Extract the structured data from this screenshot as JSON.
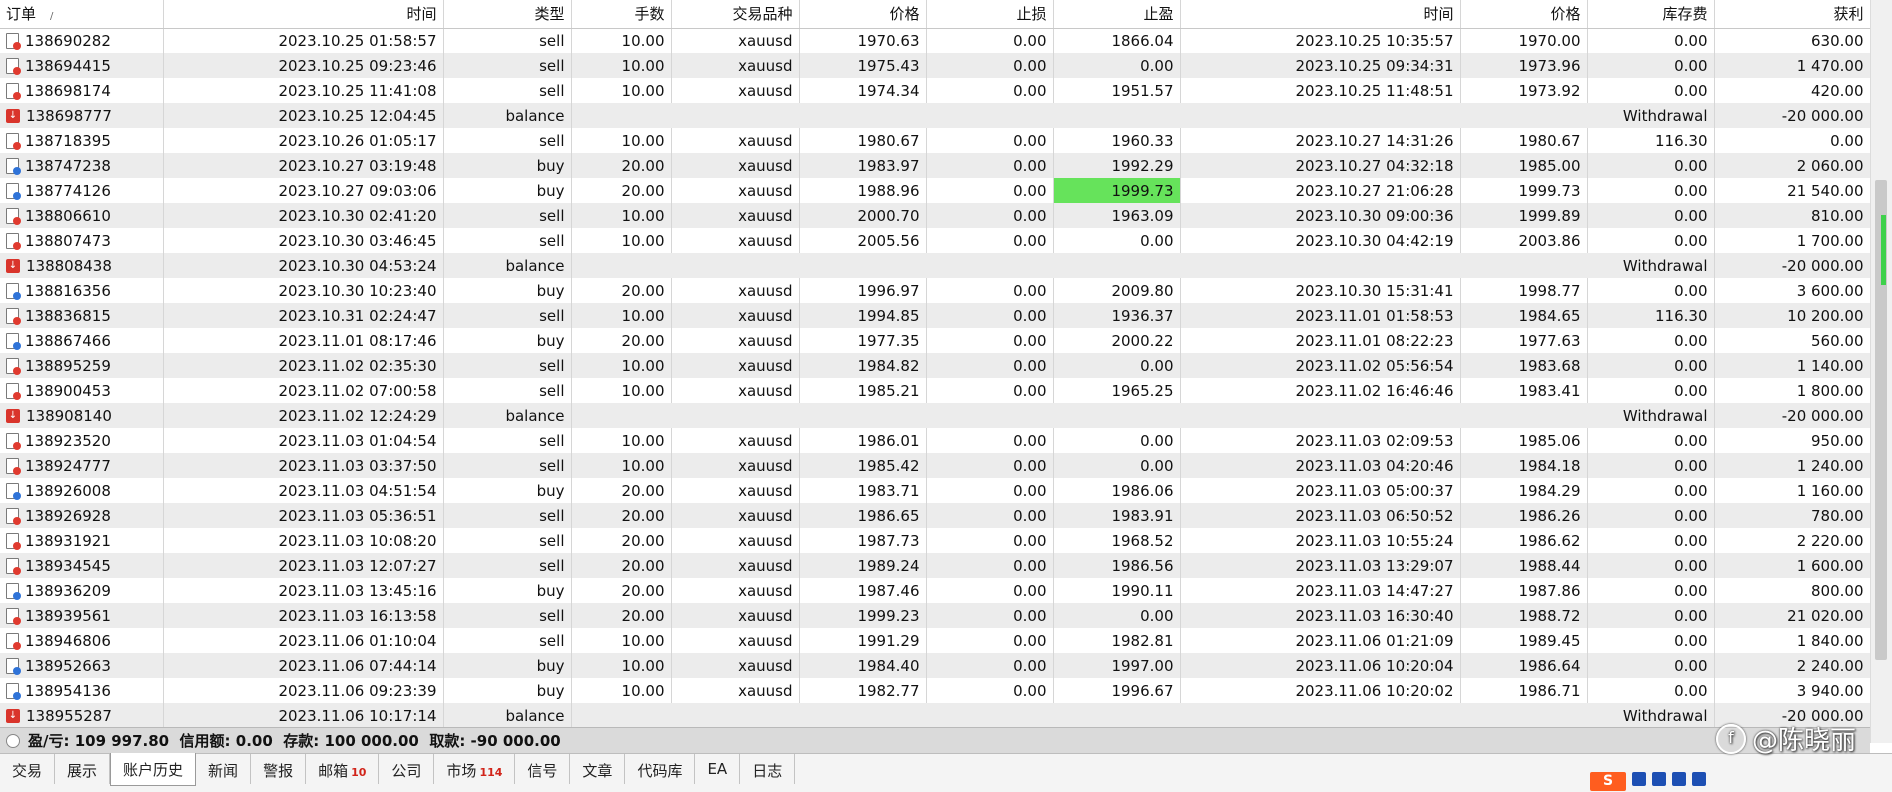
{
  "columns": [
    "订单",
    "时间",
    "类型",
    "手数",
    "交易品种",
    "价格",
    "止损",
    "止盈",
    "时间",
    "价格",
    "库存费",
    "获利"
  ],
  "rows": [
    {
      "order": "138690282",
      "time": "2023.10.25 01:58:57",
      "type": "sell",
      "lots": "10.00",
      "symbol": "xauusd",
      "price": "1970.63",
      "sl": "0.00",
      "tp": "1866.04",
      "close_time": "2023.10.25 10:35:57",
      "close_price": "1970.00",
      "swap": "0.00",
      "profit": "630.00"
    },
    {
      "order": "138694415",
      "time": "2023.10.25 09:23:46",
      "type": "sell",
      "lots": "10.00",
      "symbol": "xauusd",
      "price": "1975.43",
      "sl": "0.00",
      "tp": "0.00",
      "close_time": "2023.10.25 09:34:31",
      "close_price": "1973.96",
      "swap": "0.00",
      "profit": "1 470.00"
    },
    {
      "order": "138698174",
      "time": "2023.10.25 11:41:08",
      "type": "sell",
      "lots": "10.00",
      "symbol": "xauusd",
      "price": "1974.34",
      "sl": "0.00",
      "tp": "1951.57",
      "close_time": "2023.10.25 11:48:51",
      "close_price": "1973.92",
      "swap": "0.00",
      "profit": "420.00"
    },
    {
      "order": "138698777",
      "time": "2023.10.25 12:04:45",
      "type": "balance",
      "comment": "Withdrawal",
      "profit": "-20 000.00"
    },
    {
      "order": "138718395",
      "time": "2023.10.26 01:05:17",
      "type": "sell",
      "lots": "10.00",
      "symbol": "xauusd",
      "price": "1980.67",
      "sl": "0.00",
      "tp": "1960.33",
      "close_time": "2023.10.27 14:31:26",
      "close_price": "1980.67",
      "swap": "116.30",
      "profit": "0.00"
    },
    {
      "order": "138747238",
      "time": "2023.10.27 03:19:48",
      "type": "buy",
      "lots": "20.00",
      "symbol": "xauusd",
      "price": "1983.97",
      "sl": "0.00",
      "tp": "1992.29",
      "close_time": "2023.10.27 04:32:18",
      "close_price": "1985.00",
      "swap": "0.00",
      "profit": "2 060.00"
    },
    {
      "order": "138774126",
      "time": "2023.10.27 09:03:06",
      "type": "buy",
      "lots": "20.00",
      "symbol": "xauusd",
      "price": "1988.96",
      "sl": "0.00",
      "tp": "1999.73",
      "tp_highlight": true,
      "close_time": "2023.10.27 21:06:28",
      "close_price": "1999.73",
      "swap": "0.00",
      "profit": "21 540.00"
    },
    {
      "order": "138806610",
      "time": "2023.10.30 02:41:20",
      "type": "sell",
      "lots": "10.00",
      "symbol": "xauusd",
      "price": "2000.70",
      "sl": "0.00",
      "tp": "1963.09",
      "close_time": "2023.10.30 09:00:36",
      "close_price": "1999.89",
      "swap": "0.00",
      "profit": "810.00"
    },
    {
      "order": "138807473",
      "time": "2023.10.30 03:46:45",
      "type": "sell",
      "lots": "10.00",
      "symbol": "xauusd",
      "price": "2005.56",
      "sl": "0.00",
      "tp": "0.00",
      "close_time": "2023.10.30 04:42:19",
      "close_price": "2003.86",
      "swap": "0.00",
      "profit": "1 700.00"
    },
    {
      "order": "138808438",
      "time": "2023.10.30 04:53:24",
      "type": "balance",
      "comment": "Withdrawal",
      "profit": "-20 000.00"
    },
    {
      "order": "138816356",
      "time": "2023.10.30 10:23:40",
      "type": "buy",
      "lots": "20.00",
      "symbol": "xauusd",
      "price": "1996.97",
      "sl": "0.00",
      "tp": "2009.80",
      "close_time": "2023.10.30 15:31:41",
      "close_price": "1998.77",
      "swap": "0.00",
      "profit": "3 600.00"
    },
    {
      "order": "138836815",
      "time": "2023.10.31 02:24:47",
      "type": "sell",
      "lots": "10.00",
      "symbol": "xauusd",
      "price": "1994.85",
      "sl": "0.00",
      "tp": "1936.37",
      "close_time": "2023.11.01 01:58:53",
      "close_price": "1984.65",
      "swap": "116.30",
      "profit": "10 200.00"
    },
    {
      "order": "138867466",
      "time": "2023.11.01 08:17:46",
      "type": "buy",
      "lots": "20.00",
      "symbol": "xauusd",
      "price": "1977.35",
      "sl": "0.00",
      "tp": "2000.22",
      "close_time": "2023.11.01 08:22:23",
      "close_price": "1977.63",
      "swap": "0.00",
      "profit": "560.00"
    },
    {
      "order": "138895259",
      "time": "2023.11.02 02:35:30",
      "type": "sell",
      "lots": "10.00",
      "symbol": "xauusd",
      "price": "1984.82",
      "sl": "0.00",
      "tp": "0.00",
      "close_time": "2023.11.02 05:56:54",
      "close_price": "1983.68",
      "swap": "0.00",
      "profit": "1 140.00"
    },
    {
      "order": "138900453",
      "time": "2023.11.02 07:00:58",
      "type": "sell",
      "lots": "10.00",
      "symbol": "xauusd",
      "price": "1985.21",
      "sl": "0.00",
      "tp": "1965.25",
      "close_time": "2023.11.02 16:46:46",
      "close_price": "1983.41",
      "swap": "0.00",
      "profit": "1 800.00"
    },
    {
      "order": "138908140",
      "time": "2023.11.02 12:24:29",
      "type": "balance",
      "comment": "Withdrawal",
      "profit": "-20 000.00"
    },
    {
      "order": "138923520",
      "time": "2023.11.03 01:04:54",
      "type": "sell",
      "lots": "10.00",
      "symbol": "xauusd",
      "price": "1986.01",
      "sl": "0.00",
      "tp": "0.00",
      "close_time": "2023.11.03 02:09:53",
      "close_price": "1985.06",
      "swap": "0.00",
      "profit": "950.00"
    },
    {
      "order": "138924777",
      "time": "2023.11.03 03:37:50",
      "type": "sell",
      "lots": "10.00",
      "symbol": "xauusd",
      "price": "1985.42",
      "sl": "0.00",
      "tp": "0.00",
      "close_time": "2023.11.03 04:20:46",
      "close_price": "1984.18",
      "swap": "0.00",
      "profit": "1 240.00"
    },
    {
      "order": "138926008",
      "time": "2023.11.03 04:51:54",
      "type": "buy",
      "lots": "20.00",
      "symbol": "xauusd",
      "price": "1983.71",
      "sl": "0.00",
      "tp": "1986.06",
      "close_time": "2023.11.03 05:00:37",
      "close_price": "1984.29",
      "swap": "0.00",
      "profit": "1 160.00"
    },
    {
      "order": "138926928",
      "time": "2023.11.03 05:36:51",
      "type": "sell",
      "lots": "20.00",
      "symbol": "xauusd",
      "price": "1986.65",
      "sl": "0.00",
      "tp": "1983.91",
      "close_time": "2023.11.03 06:50:52",
      "close_price": "1986.26",
      "swap": "0.00",
      "profit": "780.00"
    },
    {
      "order": "138931921",
      "time": "2023.11.03 10:08:20",
      "type": "sell",
      "lots": "20.00",
      "symbol": "xauusd",
      "price": "1987.73",
      "sl": "0.00",
      "tp": "1968.52",
      "close_time": "2023.11.03 10:55:24",
      "close_price": "1986.62",
      "swap": "0.00",
      "profit": "2 220.00"
    },
    {
      "order": "138934545",
      "time": "2023.11.03 12:07:27",
      "type": "sell",
      "lots": "20.00",
      "symbol": "xauusd",
      "price": "1989.24",
      "sl": "0.00",
      "tp": "1986.56",
      "close_time": "2023.11.03 13:29:07",
      "close_price": "1988.44",
      "swap": "0.00",
      "profit": "1 600.00"
    },
    {
      "order": "138936209",
      "time": "2023.11.03 13:45:16",
      "type": "buy",
      "lots": "20.00",
      "symbol": "xauusd",
      "price": "1987.46",
      "sl": "0.00",
      "tp": "1990.11",
      "close_time": "2023.11.03 14:47:27",
      "close_price": "1987.86",
      "swap": "0.00",
      "profit": "800.00"
    },
    {
      "order": "138939561",
      "time": "2023.11.03 16:13:58",
      "type": "sell",
      "lots": "20.00",
      "symbol": "xauusd",
      "price": "1999.23",
      "sl": "0.00",
      "tp": "0.00",
      "close_time": "2023.11.03 16:30:40",
      "close_price": "1988.72",
      "swap": "0.00",
      "profit": "21 020.00"
    },
    {
      "order": "138946806",
      "time": "2023.11.06 01:10:04",
      "type": "sell",
      "lots": "10.00",
      "symbol": "xauusd",
      "price": "1991.29",
      "sl": "0.00",
      "tp": "1982.81",
      "close_time": "2023.11.06 01:21:09",
      "close_price": "1989.45",
      "swap": "0.00",
      "profit": "1 840.00"
    },
    {
      "order": "138952663",
      "time": "2023.11.06 07:44:14",
      "type": "buy",
      "lots": "10.00",
      "symbol": "xauusd",
      "price": "1984.40",
      "sl": "0.00",
      "tp": "1997.00",
      "close_time": "2023.11.06 10:20:04",
      "close_price": "1986.64",
      "swap": "0.00",
      "profit": "2 240.00"
    },
    {
      "order": "138954136",
      "time": "2023.11.06 09:23:39",
      "type": "buy",
      "lots": "10.00",
      "symbol": "xauusd",
      "price": "1982.77",
      "sl": "0.00",
      "tp": "1996.67",
      "close_time": "2023.11.06 10:20:02",
      "close_price": "1986.71",
      "swap": "0.00",
      "profit": "3 940.00"
    },
    {
      "order": "138955287",
      "time": "2023.11.06 10:17:14",
      "type": "balance",
      "comment": "Withdrawal",
      "profit": "-20 000.00"
    }
  ],
  "summary": {
    "text": "盈/亏: 109 997.80  信用额: 0.00  存款: 100 000.00  取款: -90 000.00"
  },
  "tabs": [
    {
      "label": "交易"
    },
    {
      "label": "展示"
    },
    {
      "label": "账户历史",
      "active": true
    },
    {
      "label": "新闻"
    },
    {
      "label": "警报"
    },
    {
      "label": "邮箱",
      "badge": "10"
    },
    {
      "label": "公司"
    },
    {
      "label": "市场",
      "badge": "114"
    },
    {
      "label": "信号"
    },
    {
      "label": "文章"
    },
    {
      "label": "代码库"
    },
    {
      "label": "EA"
    },
    {
      "label": "日志"
    }
  ],
  "watermark": "@陈晓丽",
  "colors": {
    "highlight": "#66e35b",
    "row_alt": "#ececec",
    "sell_icon": "#e03a2f",
    "buy_icon": "#2f73d8",
    "balance_icon": "#d9342b",
    "badge": "#d1241a"
  }
}
